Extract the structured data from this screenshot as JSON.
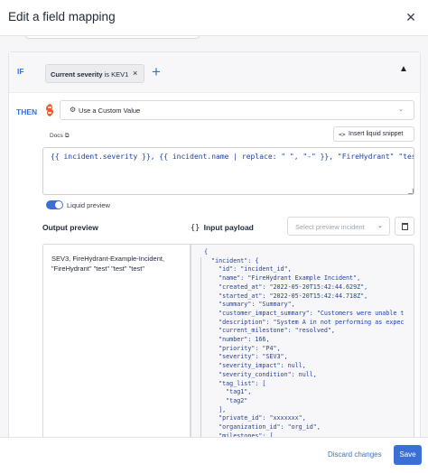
{
  "dialog": {
    "title": "Edit a field mapping",
    "close_icon": "close-icon"
  },
  "condition": {
    "if_label": "IF",
    "chip_field": "Current severity",
    "chip_op": " is ",
    "chip_value": "KEV1",
    "chip_remove": "×",
    "add": "+",
    "collapse": "⌃"
  },
  "action": {
    "then_label": "THEN",
    "select_icon": "⚙",
    "select_value": "Use a Custom Value",
    "select_chevron": "⌄"
  },
  "docs": {
    "label": "Docs",
    "ext_icon": "⧉"
  },
  "insert_snippet": {
    "icon": "<>",
    "label": "Insert liquid snippet"
  },
  "template_code": "{{ incident.severity }}, {{ incident.name | replace: \" \", \"-\" }}, \"FireHydrant\" \"test\" \"t",
  "liquid_preview": {
    "label": "Liquid preview",
    "enabled": true
  },
  "output_preview": {
    "title": "Output preview",
    "value": "SEV3, FireHydrant-Example-Incident, \"FireHydrant\" \"test\" \"test\" \"test\""
  },
  "input_payload": {
    "icon": "{}",
    "title": "Input payload",
    "select_placeholder": "Select preview incident",
    "select_chevron": "⌄",
    "lines": [
      "{",
      "  \"incident\": {",
      "    \"id\": \"incident_id\",",
      "    \"name\": \"FireHydrant Example Incident\",",
      "    \"created_at\": \"2022-05-20T15:42:44.629Z\",",
      "    \"started_at\": \"2022-05-20T15:42:44.718Z\",",
      "    \"summary\": \"Summary\",",
      "    \"customer_impact_summary\": \"Customers were unable t",
      "    \"description\": \"System A in not performing as expec",
      "    \"current_milestone\": \"resolved\",",
      "    \"number\": 166,",
      "    \"priority\": \"P4\",",
      "    \"severity\": \"SEV3\",",
      "    \"severity_impact\": null,",
      "    \"severity_condition\": null,",
      "    \"tag_list\": [",
      "      \"tag1\",",
      "      \"tag2\"",
      "    ],",
      "    \"private_id\": \"xxxxxxx\",",
      "    \"organization_id\": \"org_id\",",
      "    \"milestones\": [",
      "      {"
    ]
  },
  "footer": {
    "discard_label": "Discard changes",
    "save_label": "Save"
  },
  "colors": {
    "accent": "#3b6fd6",
    "logo": "#f05a28"
  }
}
